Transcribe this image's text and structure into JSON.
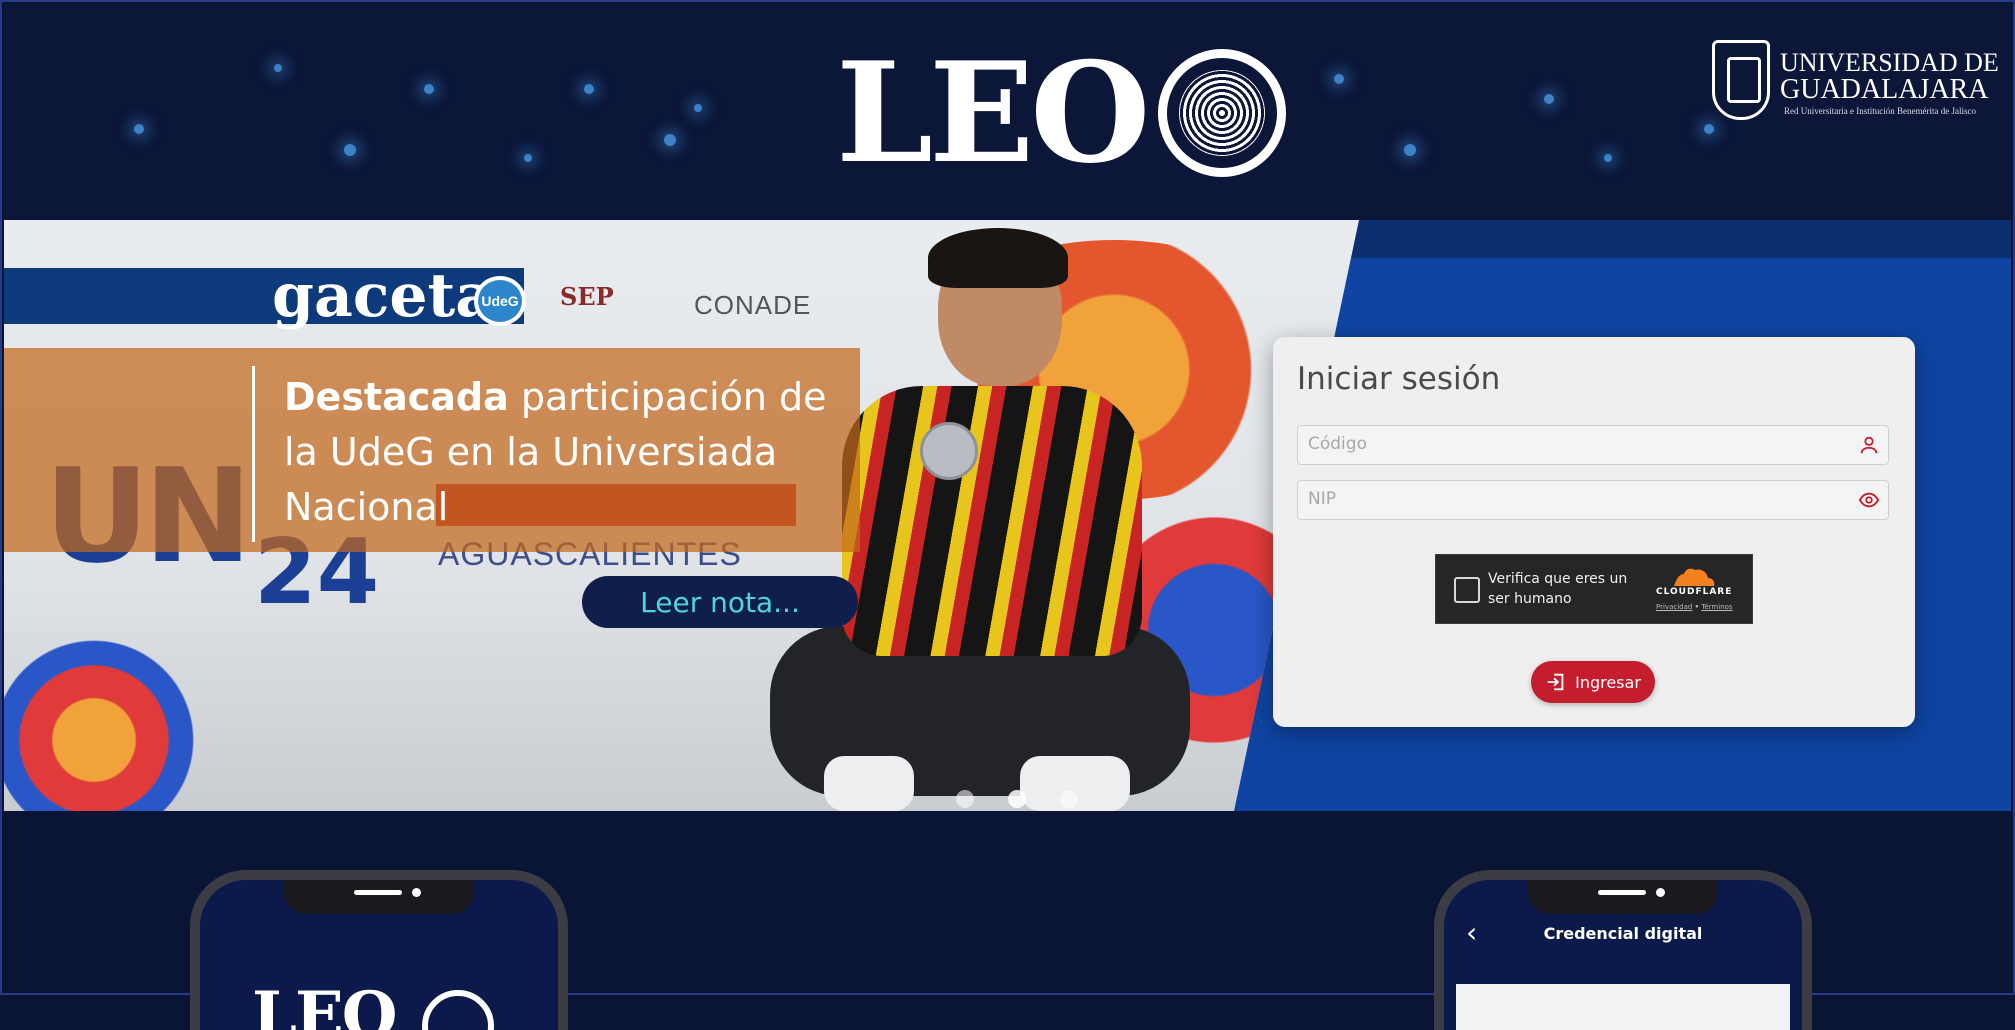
{
  "header": {
    "logo_text": "LEO",
    "university": {
      "line1": "UNIVERSIDAD DE",
      "line2": "GUADALAJARA",
      "subtitle": "Red Universitaria e Institución Benemérita de Jalisco"
    }
  },
  "carousel": {
    "brand": "gaceta",
    "brand_badge": "UdeG",
    "partner1": "SEP",
    "partner2": "CONADE",
    "photo_text_un": "UN",
    "photo_text_24": "24",
    "photo_text_city": "AGUASCALIENTES",
    "headline_bold": "Destacada",
    "headline_rest": " participación de la UdeG en la Universiada Nacional",
    "cta_label": "Leer nota...",
    "slide_count": 3,
    "active_slide": 2
  },
  "login": {
    "title": "Iniciar sesión",
    "codigo_placeholder": "Código",
    "nip_placeholder": "NIP",
    "captcha_label": "Verifica que eres un ser humano",
    "captcha_brand": "CLOUDFLARE",
    "captcha_privacy": "Privacidad",
    "captcha_sep": "•",
    "captcha_terms": "Términos",
    "submit_label": "Ingresar"
  },
  "phones": {
    "left_logo": "LEO",
    "right_title": "Credencial digital",
    "right_back": "‹"
  },
  "colors": {
    "page_bg": "#0a1536",
    "accent_blue": "#0f44a3",
    "submit_red": "#c51d2e",
    "cta_text": "#4fd4da"
  }
}
